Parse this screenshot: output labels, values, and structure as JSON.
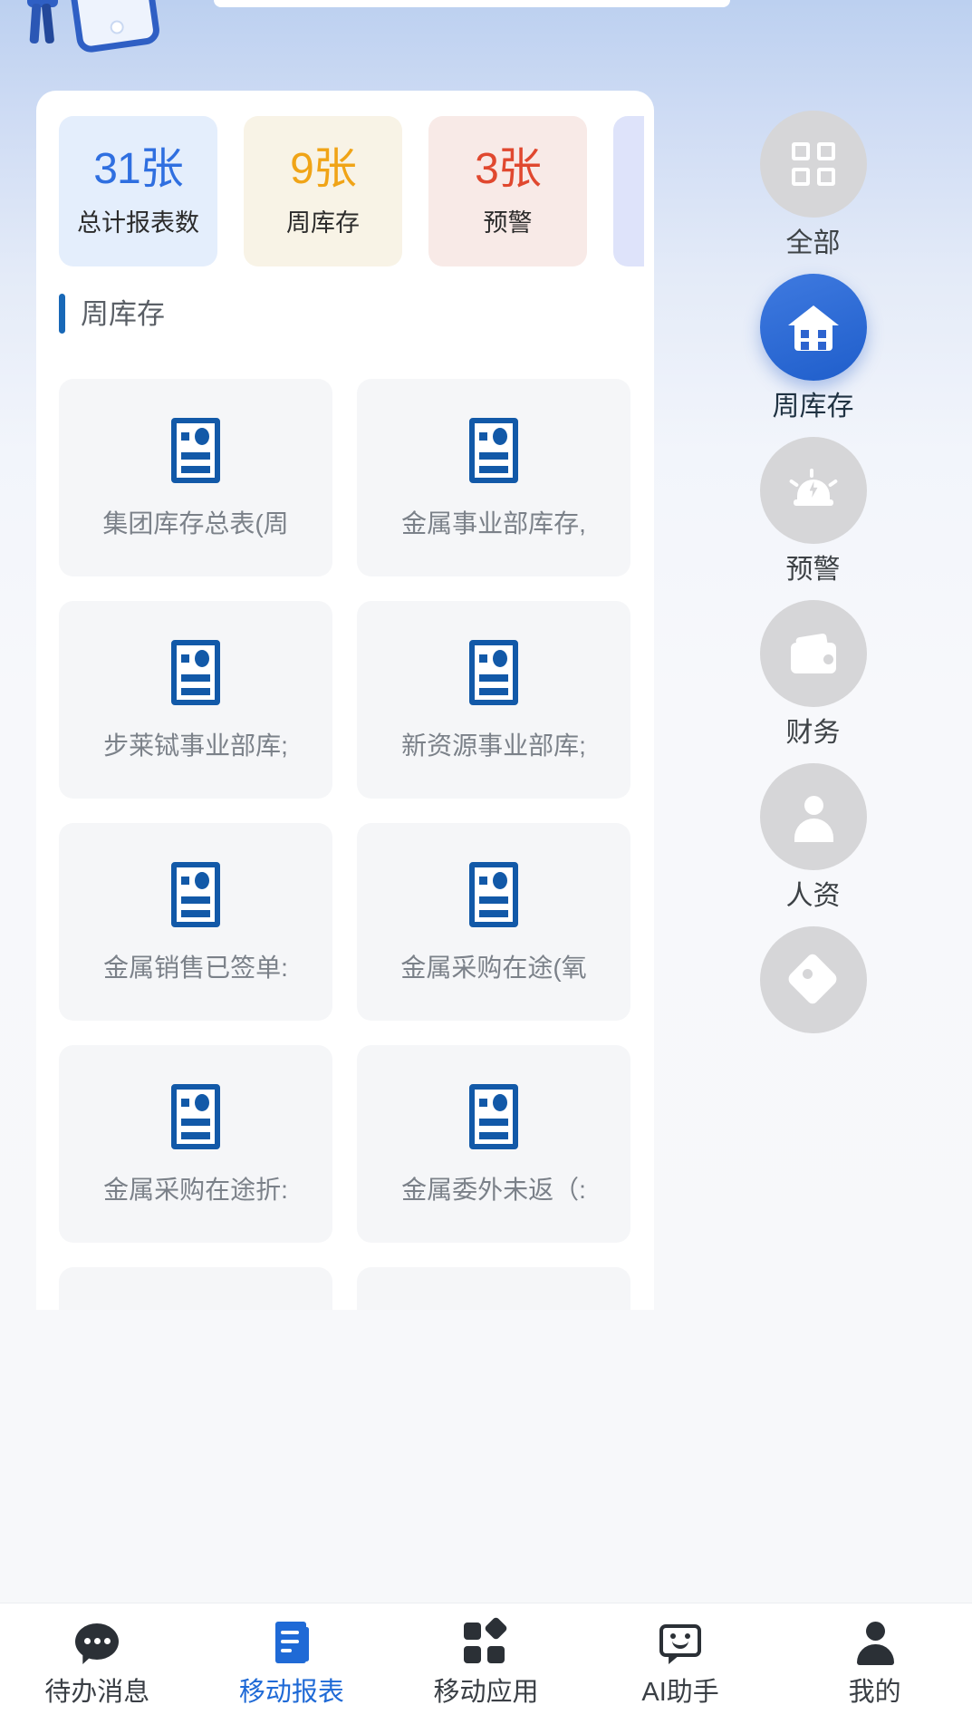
{
  "stats": [
    {
      "value": "31张",
      "label": "总计报表数",
      "value_color": "#2f6fe0",
      "bg": "#e4eefc"
    },
    {
      "value": "9张",
      "label": "周库存",
      "value_color": "#f0a417",
      "bg": "#f8f3e6"
    },
    {
      "value": "3张",
      "label": "预警",
      "value_color": "#e0482f",
      "bg": "#f8eae7"
    }
  ],
  "stat_partial_bg": "#dee3fa",
  "section": {
    "title": "周库存",
    "accent": "#1868b7"
  },
  "reports": [
    {
      "label": "集团库存总表(周"
    },
    {
      "label": "金属事业部库存,"
    },
    {
      "label": "步莱铽事业部库;"
    },
    {
      "label": "新资源事业部库;"
    },
    {
      "label": "金属销售已签单:"
    },
    {
      "label": "金属采购在途(氧"
    },
    {
      "label": "金属采购在途折:"
    },
    {
      "label": "金属委外未返（:"
    }
  ],
  "rail": [
    {
      "label": "全部",
      "icon": "grid-icon",
      "active": false
    },
    {
      "label": "周库存",
      "icon": "house-icon",
      "active": true
    },
    {
      "label": "预警",
      "icon": "alarm-icon",
      "active": false
    },
    {
      "label": "财务",
      "icon": "wallet-icon",
      "active": false
    },
    {
      "label": "人资",
      "icon": "person-icon",
      "active": false
    },
    {
      "label": "",
      "icon": "tag-icon",
      "active": false
    }
  ],
  "tabs": [
    {
      "label": "待办消息",
      "icon": "chat-icon",
      "active": false
    },
    {
      "label": "移动报表",
      "icon": "report-icon",
      "active": true
    },
    {
      "label": "移动应用",
      "icon": "apps-icon",
      "active": false
    },
    {
      "label": "AI助手",
      "icon": "ai-icon",
      "active": false
    },
    {
      "label": "我的",
      "icon": "profile-icon",
      "active": false
    }
  ],
  "colors": {
    "brand": "#1f6ad6",
    "doc_icon": "#1259a8",
    "card_bg": "#f5f6f8"
  }
}
